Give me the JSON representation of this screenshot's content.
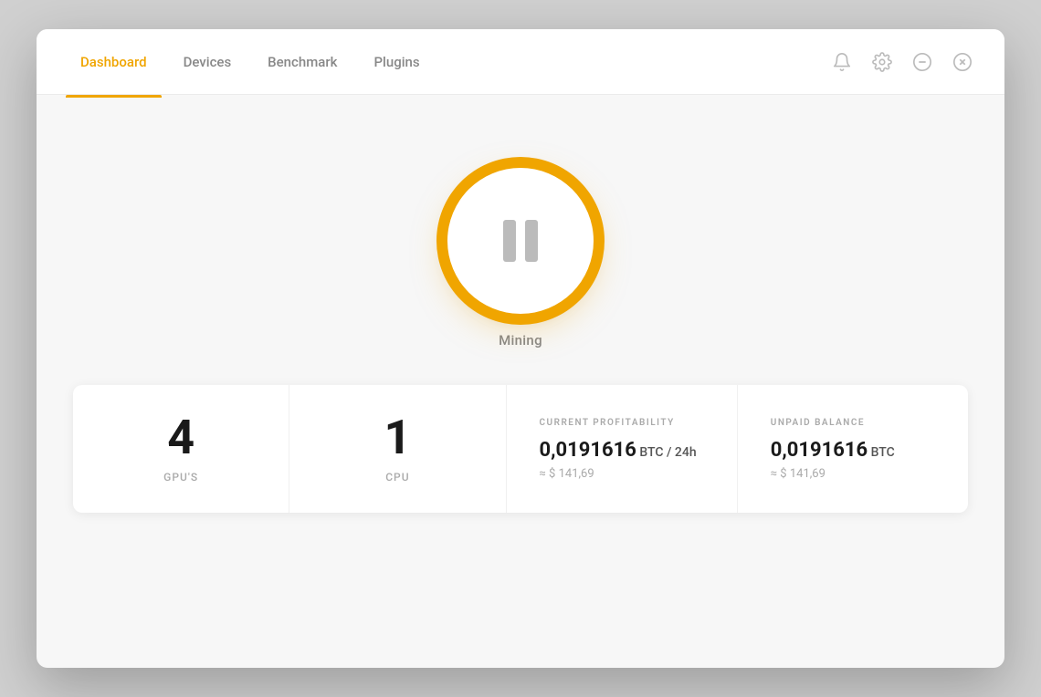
{
  "nav": {
    "tabs": [
      {
        "id": "dashboard",
        "label": "Dashboard",
        "active": true
      },
      {
        "id": "devices",
        "label": "Devices",
        "active": false
      },
      {
        "id": "benchmark",
        "label": "Benchmark",
        "active": false
      },
      {
        "id": "plugins",
        "label": "Plugins",
        "active": false
      }
    ]
  },
  "header_icons": {
    "bell": "🔔",
    "gear": "⚙",
    "minimize": "⊖",
    "close": "⊗"
  },
  "mining": {
    "status_label": "Mining"
  },
  "stats": {
    "gpus": {
      "count": "4",
      "label": "GPU'S"
    },
    "cpu": {
      "count": "1",
      "label": "CPU"
    },
    "profitability": {
      "title": "CURRENT PROFITABILITY",
      "btc_value": "0,0191616",
      "btc_unit": " BTC / 24h",
      "usd_approx": "≈ $ 141,69"
    },
    "balance": {
      "title": "UNPAID BALANCE",
      "btc_value": "0,0191616",
      "btc_unit": " BTC",
      "usd_approx": "≈ $ 141,69"
    }
  }
}
